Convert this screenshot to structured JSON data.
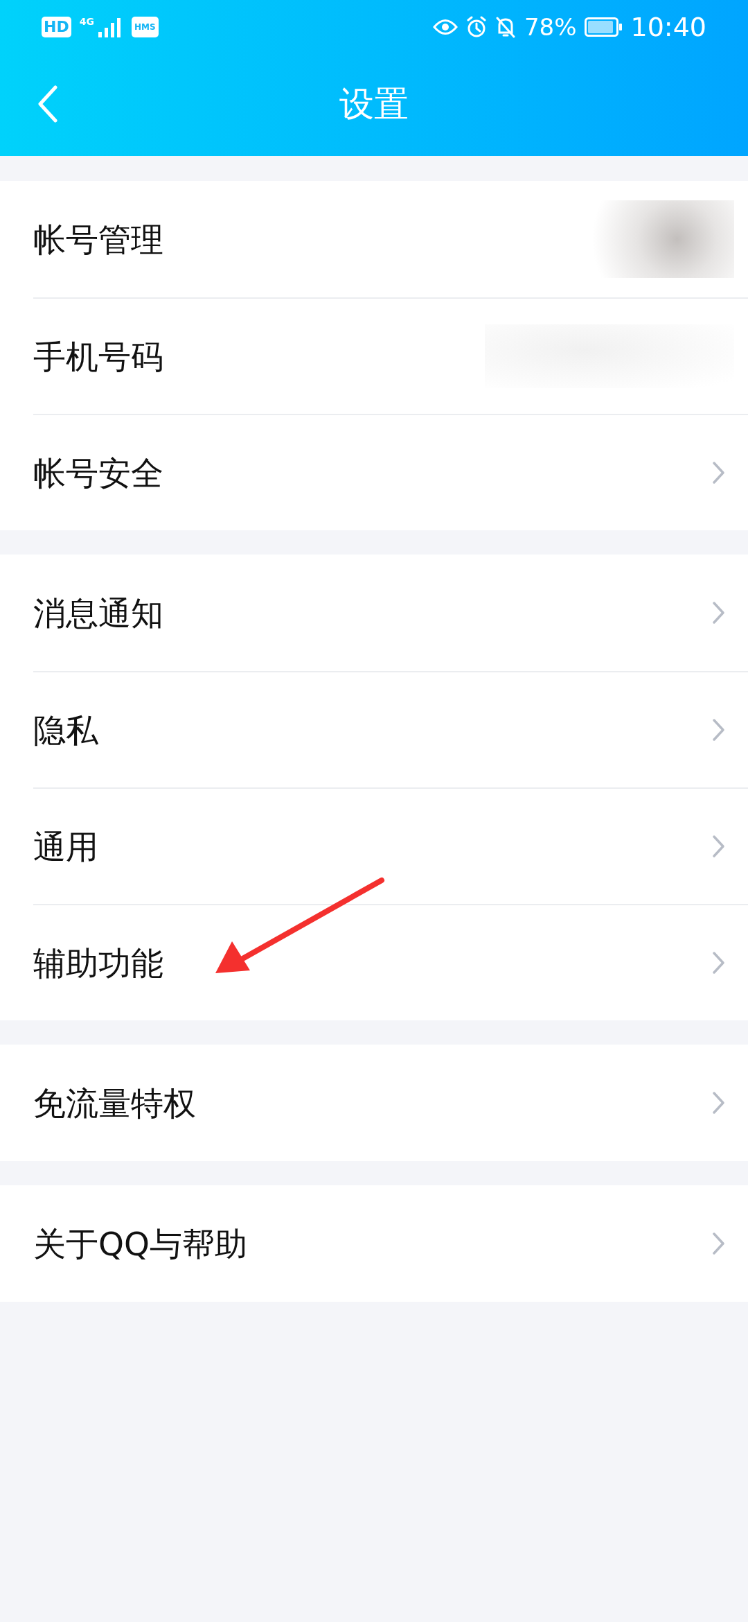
{
  "status_bar": {
    "badges": [
      "HD",
      "HMS"
    ],
    "network": "4G",
    "battery": "78%",
    "time": "10:40"
  },
  "header": {
    "title": "设置"
  },
  "groups": [
    {
      "items": [
        {
          "label": "帐号管理",
          "kind": "blurred-avatar"
        },
        {
          "label": "手机号码",
          "kind": "blurred-text"
        },
        {
          "label": "帐号安全",
          "kind": "chevron"
        }
      ]
    },
    {
      "items": [
        {
          "label": "消息通知",
          "kind": "chevron"
        },
        {
          "label": "隐私",
          "kind": "chevron"
        },
        {
          "label": "通用",
          "kind": "chevron"
        },
        {
          "label": "辅助功能",
          "kind": "chevron"
        }
      ]
    },
    {
      "items": [
        {
          "label": "免流量特权",
          "kind": "chevron"
        }
      ]
    },
    {
      "items": [
        {
          "label": "关于QQ与帮助",
          "kind": "chevron"
        }
      ]
    }
  ]
}
